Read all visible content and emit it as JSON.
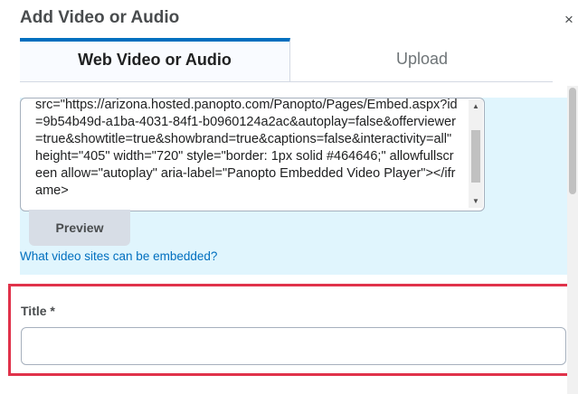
{
  "dialog": {
    "title": "Add Video or Audio",
    "close_glyph": "×"
  },
  "tabs": [
    {
      "label": "Web Video or Audio",
      "active": true
    },
    {
      "label": "Upload",
      "active": false
    }
  ],
  "embed": {
    "code": "src=\"https://arizona.hosted.panopto.com/Panopto/Pages/Embed.aspx?id=9b54b49d-a1ba-4031-84f1-b0960124a2ac&autoplay=false&offerviewer=true&showtitle=true&showbrand=true&captions=false&interactivity=all\" height=\"405\" width=\"720\" style=\"border: 1px solid #464646;\" allowfullscreen allow=\"autoplay\" aria-label=\"Panopto Embedded Video Player\"></iframe>",
    "preview_label": "Preview",
    "help_link": "What video sites can be embedded?"
  },
  "title_field": {
    "label": "Title *",
    "value": ""
  },
  "colors": {
    "accent": "#006fbf",
    "highlight": "#e0324a",
    "panel": "#e0f5fd"
  },
  "icons": {
    "close": "close-icon",
    "scroll_up": "arrow-up-icon",
    "scroll_down": "arrow-down-icon"
  }
}
